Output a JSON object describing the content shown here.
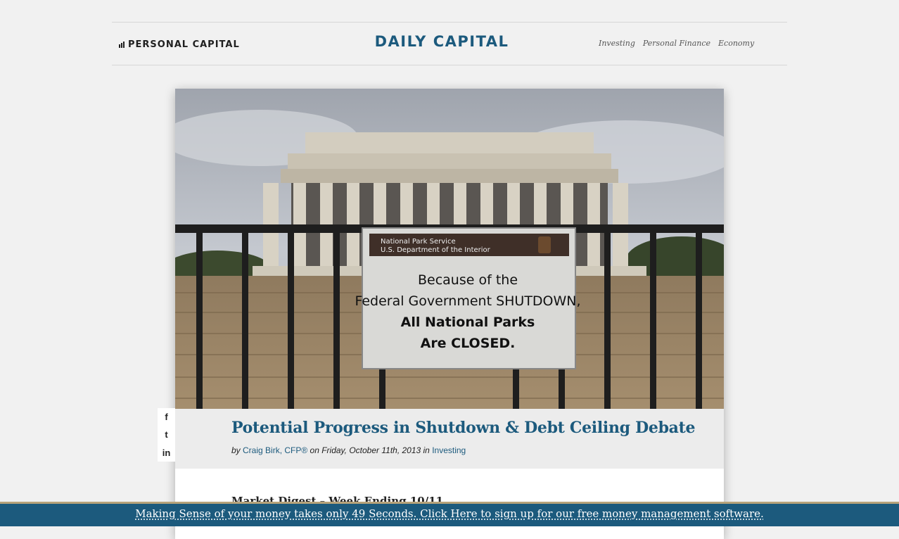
{
  "header": {
    "brand": "PERSONAL CAPITAL",
    "site_title": "DAILY CAPITAL",
    "nav": [
      "Investing",
      "Personal Finance",
      "Economy"
    ]
  },
  "hero": {
    "sign": {
      "agency_line1": "National Park Service",
      "agency_line2": "U.S. Department of the Interior",
      "line1": "Because of the",
      "line2": "Federal Government SHUTDOWN,",
      "line3": "All National Parks",
      "line4": "Are CLOSED."
    }
  },
  "post": {
    "title": "Potential Progress in Shutdown & Debt Ceiling Debate",
    "by_prefix": "by ",
    "author": "Craig Birk, CFP®",
    "date_text": " on Friday, October 11th, 2013 in ",
    "category": "Investing",
    "first_heading": "Market Digest – Week Ending 10/11"
  },
  "social": {
    "facebook": "f",
    "twitter": "t",
    "linkedin": "in"
  },
  "cta": {
    "text": "Making Sense of your money takes only 49 Seconds. Click Here to sign up for our free money management software."
  },
  "colors": {
    "brand_blue": "#1c5a7d",
    "background": "#f1f1f1",
    "cta_border": "#b7a37a"
  }
}
